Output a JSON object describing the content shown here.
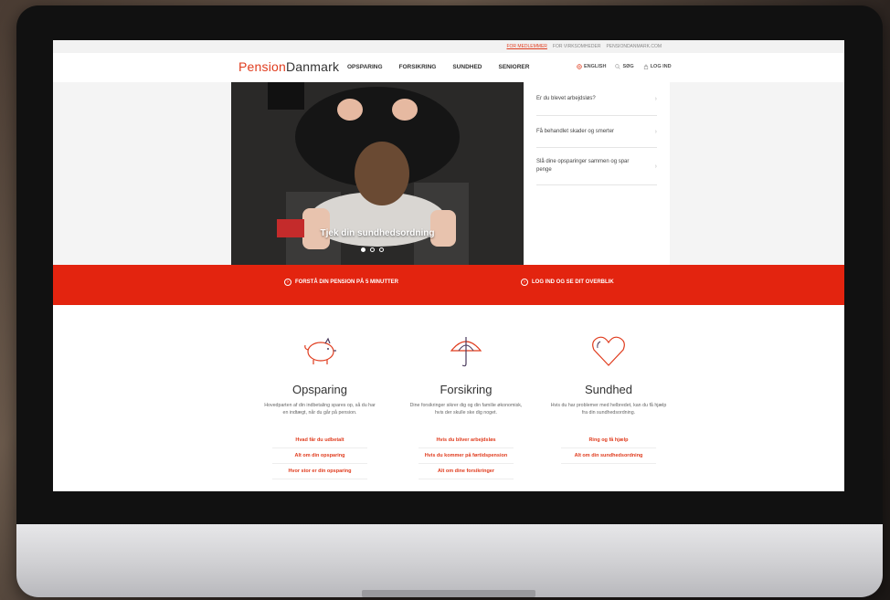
{
  "utility_bar": {
    "links": [
      "FOR MEDLEMMER",
      "FOR VIRKSOMHEDER",
      "PENSIONDANMARK.COM"
    ]
  },
  "header": {
    "logo": {
      "part1": "Pension",
      "part2": "Danmark"
    },
    "menu": [
      "OPSPARING",
      "FORSIKRING",
      "SUNDHED",
      "SENIORER"
    ],
    "english": "ENGLISH",
    "search": "SØG",
    "login": "LOG IND"
  },
  "hero": {
    "caption": "Tjek din sundhedsordning",
    "side_items": [
      "Er du blevet arbejdsløs?",
      "Få behandlet skader og smerter",
      "Slå dine opsparinger sammen og spar penge"
    ]
  },
  "band": {
    "left": "FORSTÅ DIN PENSION PÅ 5 MINUTTER",
    "right": "LOG IND OG SE DIT OVERBLIK"
  },
  "columns": [
    {
      "title": "Opsparing",
      "icon": "piggy-bank-icon",
      "desc": "Hovedparten af din indbetaling spares op, så du har en indtægt, når du går på pension.",
      "links": [
        "Hvad får du udbetalt",
        "Alt om din opsparing",
        "Hvor stor er din opsparing"
      ]
    },
    {
      "title": "Forsikring",
      "icon": "umbrella-icon",
      "desc": "Dine forsikringer sikrer dig og din familie økonomisk, hvis der skulle ske dig noget.",
      "links": [
        "Hvis du bliver arbejdsløs",
        "Hvis du kommer på førtidspension",
        "Alt om dine forsikringer"
      ]
    },
    {
      "title": "Sundhed",
      "icon": "heart-icon",
      "desc": "Hvis du har problemer med helbredet, kan du få hjælp fra din sundhedsordning.",
      "links": [
        "Ring og få hjælp",
        "Alt om din sundhedsordning"
      ]
    }
  ],
  "colors": {
    "brand_red": "#e3240f",
    "link_red": "#e03c1e"
  }
}
